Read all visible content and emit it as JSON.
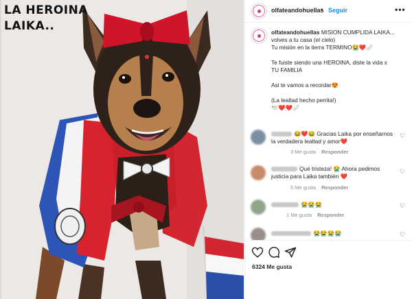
{
  "photo": {
    "overlay_text": "LA HEROINA\nLAIKA.."
  },
  "header": {
    "username": "olfateandohuellas",
    "separator": "•",
    "follow_label": "Seguir",
    "more_label": "•••"
  },
  "caption": {
    "username": "olfateandohuellas",
    "lines": [
      "MISION CUMPLIDA LAIKA...",
      "volves a tu casa (el cielo)",
      "Tu misión en la tierra TERMINO😭❤️🩹",
      "",
      "Te fuiste siendo una HEROINA, diste la vida x",
      "TU FAMILIA",
      "",
      "Asi te vamos a recordar😍",
      "",
      "(La lealtad hecho perrita!)",
      "🕊️❤️❤️🩹"
    ]
  },
  "comments": [
    {
      "text_line1": "😂❤️😂 Gracias Laika por enseñarnos",
      "text_line2": "la verdadera lealtad y amor❤️",
      "likes": "3 Me gusta",
      "reply": "Responder",
      "avatar_color": "#7d8fa3"
    },
    {
      "text_line1": "Qué tristeza! 😭 Ahora pedimos",
      "text_line2": "justicia para Laika también ❤️",
      "likes": "5 Me gusta",
      "reply": "Responder",
      "avatar_color": "#c98a6a"
    },
    {
      "text_line1": "😭😭😭",
      "text_line2": "",
      "likes": "1 Me gusta",
      "reply": "Responder",
      "avatar_color": "#8fa58a"
    },
    {
      "text_line1": "😭😭😭😭",
      "text_line2": "",
      "likes": "",
      "reply": "",
      "avatar_color": "#9a8f8a"
    }
  ],
  "actions": {
    "like_icon": "heart-icon",
    "comment_icon": "comment-icon",
    "share_icon": "share-icon",
    "likes_count": "6324 Me gusta"
  },
  "colors": {
    "accent": "#0095f6",
    "muted": "#8e8e8e",
    "text": "#262626"
  }
}
